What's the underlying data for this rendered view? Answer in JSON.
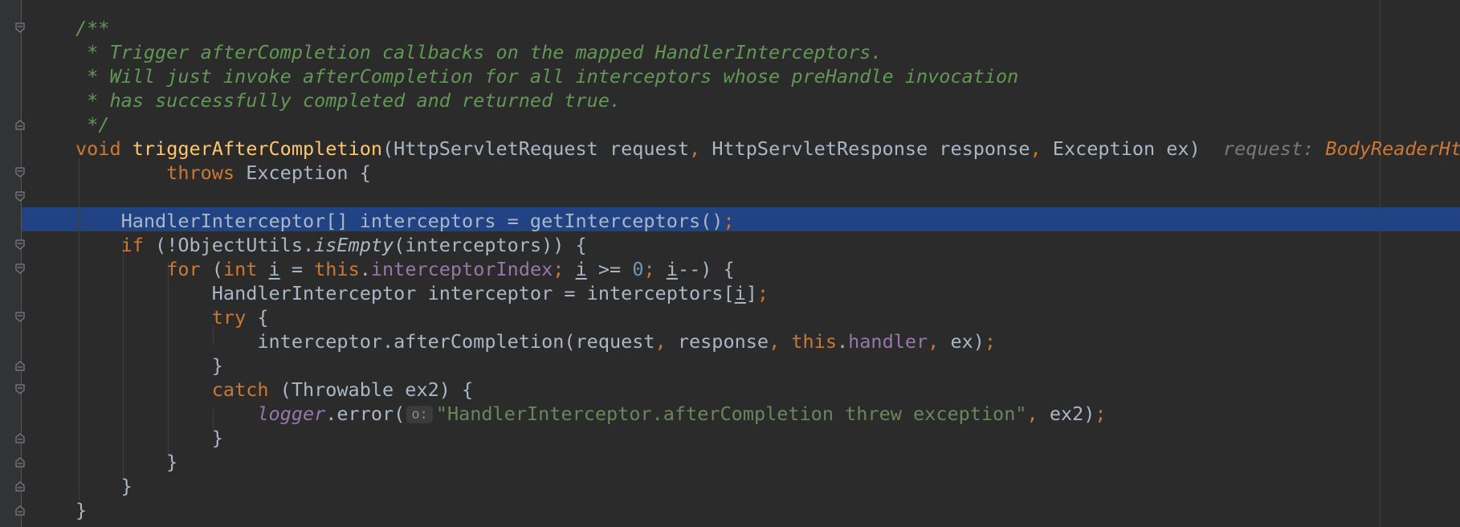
{
  "code_lines": [
    {
      "id": "l1",
      "tokens": [
        {
          "c": "cmt",
          "t": "/**"
        }
      ]
    },
    {
      "id": "l2",
      "tokens": [
        {
          "c": "cmt",
          "t": " * Trigger afterCompletion callbacks on the mapped HandlerInterceptors."
        }
      ]
    },
    {
      "id": "l3",
      "tokens": [
        {
          "c": "cmt",
          "t": " * Will just invoke afterCompletion for all interceptors whose preHandle invocation"
        }
      ]
    },
    {
      "id": "l4",
      "tokens": [
        {
          "c": "cmt",
          "t": " * has successfully completed and returned true."
        }
      ]
    },
    {
      "id": "l5",
      "tokens": [
        {
          "c": "cmt",
          "t": " */"
        }
      ]
    },
    {
      "id": "l6",
      "tokens": [
        {
          "c": "kw",
          "t": "void "
        },
        {
          "c": "fn",
          "t": "triggerAfterCompletion"
        },
        {
          "c": "",
          "t": "(HttpServletRequest request"
        },
        {
          "c": "semi",
          "t": ","
        },
        {
          "c": "",
          "t": " HttpServletResponse response"
        },
        {
          "c": "semi",
          "t": ","
        },
        {
          "c": "",
          "t": " Exception ex)  "
        },
        {
          "c": "hint-label",
          "t": "request: "
        },
        {
          "c": "hint-value",
          "t": "BodyReaderHttpServletRequestWrapper"
        }
      ]
    },
    {
      "id": "l7",
      "tokens": [
        {
          "c": "",
          "t": "        "
        },
        {
          "c": "kw",
          "t": "throws "
        },
        {
          "c": "",
          "t": "Exception {"
        }
      ]
    },
    {
      "id": "l8",
      "tokens": []
    },
    {
      "id": "l9",
      "tokens": [
        {
          "c": "",
          "t": "    HandlerInterceptor[] interceptors = getInterceptors()"
        },
        {
          "c": "semi",
          "t": ";"
        }
      ]
    },
    {
      "id": "l10",
      "tokens": [
        {
          "c": "",
          "t": "    "
        },
        {
          "c": "kw",
          "t": "if "
        },
        {
          "c": "",
          "t": "(!ObjectUtils."
        },
        {
          "c": "ital",
          "t": "isEmpty"
        },
        {
          "c": "",
          "t": "(interceptors)) {"
        }
      ]
    },
    {
      "id": "l11",
      "tokens": [
        {
          "c": "",
          "t": "        "
        },
        {
          "c": "kw",
          "t": "for "
        },
        {
          "c": "",
          "t": "("
        },
        {
          "c": "kw",
          "t": "int "
        },
        {
          "c": "und",
          "t": "i"
        },
        {
          "c": "",
          "t": " = "
        },
        {
          "c": "kw",
          "t": "this"
        },
        {
          "c": "",
          "t": "."
        },
        {
          "c": "fld",
          "t": "interceptorIndex"
        },
        {
          "c": "semi",
          "t": ";"
        },
        {
          "c": "",
          "t": " "
        },
        {
          "c": "und",
          "t": "i"
        },
        {
          "c": "",
          "t": " >= "
        },
        {
          "c": "num",
          "t": "0"
        },
        {
          "c": "semi",
          "t": ";"
        },
        {
          "c": "",
          "t": " "
        },
        {
          "c": "und",
          "t": "i"
        },
        {
          "c": "",
          "t": "--) {"
        }
      ]
    },
    {
      "id": "l12",
      "tokens": [
        {
          "c": "",
          "t": "            HandlerInterceptor interceptor = interceptors["
        },
        {
          "c": "und",
          "t": "i"
        },
        {
          "c": "",
          "t": "]"
        },
        {
          "c": "semi",
          "t": ";"
        }
      ]
    },
    {
      "id": "l13",
      "tokens": [
        {
          "c": "",
          "t": "            "
        },
        {
          "c": "kw",
          "t": "try "
        },
        {
          "c": "",
          "t": "{"
        }
      ]
    },
    {
      "id": "l14",
      "tokens": [
        {
          "c": "",
          "t": "                interceptor.afterCompletion(request"
        },
        {
          "c": "semi",
          "t": ","
        },
        {
          "c": "",
          "t": " response"
        },
        {
          "c": "semi",
          "t": ","
        },
        {
          "c": "",
          "t": " "
        },
        {
          "c": "kw",
          "t": "this"
        },
        {
          "c": "",
          "t": "."
        },
        {
          "c": "fld",
          "t": "handler"
        },
        {
          "c": "semi",
          "t": ","
        },
        {
          "c": "",
          "t": " ex)"
        },
        {
          "c": "semi",
          "t": ";"
        }
      ]
    },
    {
      "id": "l15",
      "tokens": [
        {
          "c": "",
          "t": "            }"
        }
      ]
    },
    {
      "id": "l16",
      "tokens": [
        {
          "c": "",
          "t": "            "
        },
        {
          "c": "kw",
          "t": "catch "
        },
        {
          "c": "",
          "t": "(Throwable ex2) {"
        }
      ]
    },
    {
      "id": "l17",
      "tokens": [
        {
          "c": "",
          "t": "                "
        },
        {
          "c": "loggerc",
          "t": "logger"
        },
        {
          "c": "",
          "t": ".error("
        },
        {
          "c": "param-hint",
          "t": "o:"
        },
        {
          "c": "str",
          "t": "\"HandlerInterceptor.afterCompletion threw exception\""
        },
        {
          "c": "semi",
          "t": ","
        },
        {
          "c": "",
          "t": " ex2)"
        },
        {
          "c": "semi",
          "t": ";"
        }
      ]
    },
    {
      "id": "l18",
      "tokens": [
        {
          "c": "",
          "t": "            }"
        }
      ]
    },
    {
      "id": "l19",
      "tokens": [
        {
          "c": "",
          "t": "        }"
        }
      ]
    },
    {
      "id": "l20",
      "tokens": [
        {
          "c": "",
          "t": "    }"
        }
      ]
    },
    {
      "id": "l21",
      "tokens": [
        {
          "c": "",
          "t": "}"
        }
      ]
    }
  ],
  "colors": {
    "background": "#2b2b2b",
    "selection": "#214283",
    "keyword": "#cc7832",
    "method": "#ffc66d",
    "comment": "#629755",
    "field": "#9876aa",
    "number": "#6897bb",
    "string": "#6a8759",
    "text": "#a9b7c6"
  },
  "gutter_icons": [
    "fold-open-icon",
    "fold-close-icon"
  ]
}
